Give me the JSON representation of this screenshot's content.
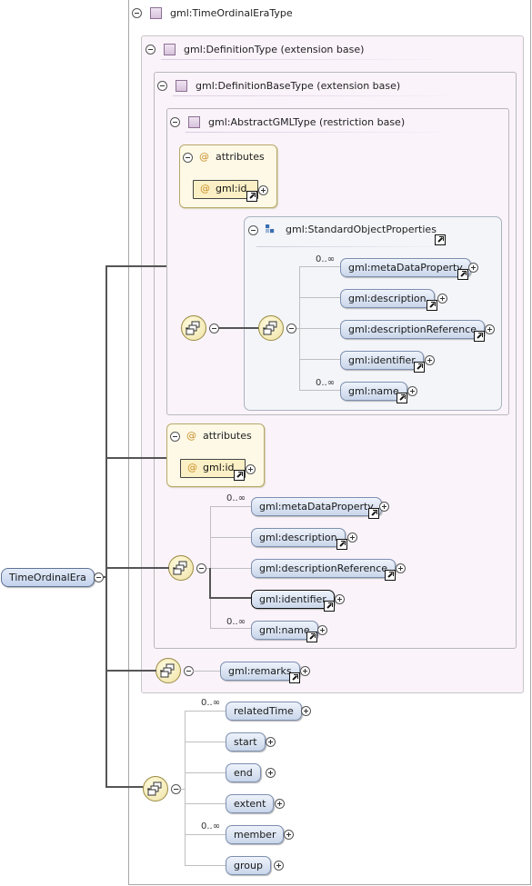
{
  "types": {
    "outer": "gml:TimeOrdinalEraType",
    "definition": "gml:DefinitionType (extension base)",
    "definition_base": "gml:DefinitionBaseType (extension base)",
    "abstract_gml": "gml:AbstractGMLType (restriction base)"
  },
  "attributes_label": "attributes",
  "attribute_id": "gml:id",
  "group": {
    "name": "gml:StandardObjectProperties",
    "elements": [
      {
        "label": "gml:metaDataProperty",
        "occurs": "0..∞"
      },
      {
        "label": "gml:description",
        "occurs": ""
      },
      {
        "label": "gml:descriptionReference",
        "occurs": ""
      },
      {
        "label": "gml:identifier",
        "occurs": ""
      },
      {
        "label": "gml:name",
        "occurs": "0..∞"
      }
    ]
  },
  "definition_base_elements": [
    {
      "label": "gml:metaDataProperty",
      "occurs": "0..∞"
    },
    {
      "label": "gml:description",
      "occurs": ""
    },
    {
      "label": "gml:descriptionReference",
      "occurs": ""
    },
    {
      "label": "gml:identifier",
      "occurs": ""
    },
    {
      "label": "gml:name",
      "occurs": "0..∞"
    }
  ],
  "remarks": "gml:remarks",
  "root_element": "TimeOrdinalEra",
  "era_elements": [
    {
      "label": "relatedTime",
      "occurs": "0..∞"
    },
    {
      "label": "start",
      "occurs": ""
    },
    {
      "label": "end",
      "occurs": ""
    },
    {
      "label": "extent",
      "occurs": ""
    },
    {
      "label": "member",
      "occurs": "0..∞"
    },
    {
      "label": "group",
      "occurs": ""
    }
  ]
}
